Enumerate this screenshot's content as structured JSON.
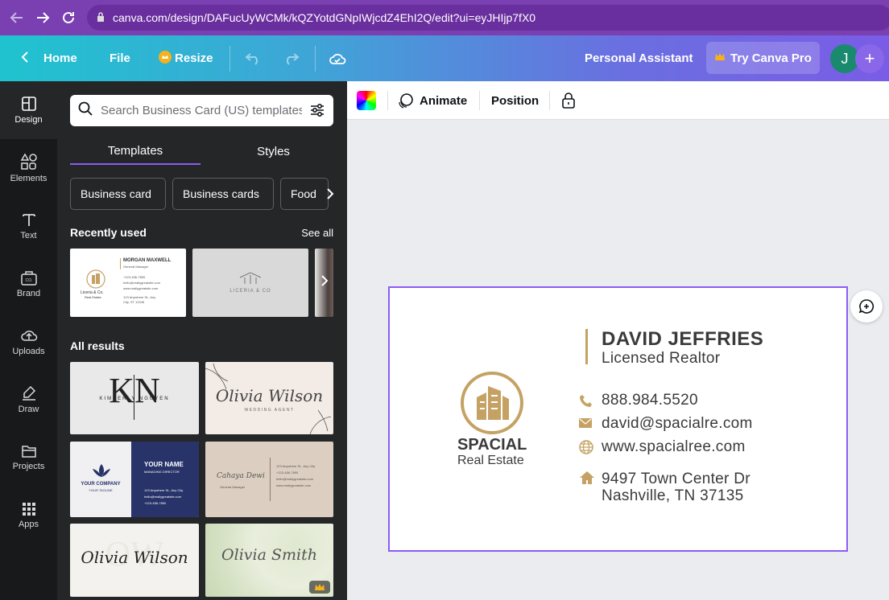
{
  "browser": {
    "url": "canva.com/design/DAFucUyWCMk/kQZYotdGNpIWjcdZ4EhI2Q/edit?ui=eyJHIjp7fX0"
  },
  "topbar": {
    "home_label": "Home",
    "file_label": "File",
    "resize_label": "Resize",
    "assistant_label": "Personal Assistant",
    "try_pro_label": "Try Canva Pro",
    "avatar_initial": "J",
    "plus_label": "+"
  },
  "rail": {
    "items": [
      {
        "label": "Design",
        "icon": "design-icon"
      },
      {
        "label": "Elements",
        "icon": "elements-icon"
      },
      {
        "label": "Text",
        "icon": "text-icon"
      },
      {
        "label": "Brand",
        "icon": "brand-icon"
      },
      {
        "label": "Uploads",
        "icon": "uploads-icon"
      },
      {
        "label": "Draw",
        "icon": "draw-icon"
      },
      {
        "label": "Projects",
        "icon": "projects-icon"
      },
      {
        "label": "Apps",
        "icon": "apps-icon"
      }
    ]
  },
  "panel": {
    "search_placeholder": "Search Business Card (US) templates",
    "tabs": [
      "Templates",
      "Styles"
    ],
    "chips": [
      "Business card",
      "Business cards",
      "Food"
    ],
    "recently_used": "Recently used",
    "see_all": "See all",
    "all_results": "All results",
    "recent_thumbs": [
      {
        "name": "MORGAN MAXWELL",
        "role": "General Manager",
        "brand": "Liceria & Co.",
        "sub": "Real Estate",
        "phone": "+123-456-7890",
        "email": "hello@reallygreatsite.com",
        "web": "www.reallygreatsite.com",
        "addr1": "123 Anywhere St., Any",
        "addr2": "City, ST 12345"
      },
      {
        "brand": "LICERIA & CO"
      }
    ],
    "results": [
      {
        "text": "KIMBERLY NGUYEN",
        "mono": "KN"
      },
      {
        "text": "Olivia Wilson",
        "sub": "WEDDING AGENT"
      },
      {
        "company": "YOUR COMPANY",
        "tagline": "YOUR TAGLINE",
        "name": "YOUR NAME",
        "title": "MANAGING DIRECTOR",
        "addr": "123 Anywhere St., Any City",
        "email": "hello@reallygreatsite.com",
        "phone": "+123-456-7890"
      },
      {
        "name": "Cahaya Dewi",
        "title": "General Manager",
        "addr": "123 Anywhere St., Any City",
        "phone": "+123-456-7890",
        "email": "hello@reallygreatsite.com",
        "web": "www.reallygreatsite.com"
      },
      {
        "text": "Olivia Wilson",
        "mono": "OW"
      },
      {
        "text": "Olivia Smith"
      }
    ]
  },
  "toolbar": {
    "animate_label": "Animate",
    "position_label": "Position"
  },
  "card": {
    "brand_line1": "SPACIAL",
    "brand_line2": "Real Estate",
    "name": "DAVID JEFFRIES",
    "role": "Licensed Realtor",
    "phone": "888.984.5520",
    "email": "david@spacialre.com",
    "website": "www.spacialree.com",
    "address_line1": "9497 Town Center Dr",
    "address_line2": "Nashville, TN 37135",
    "accent_color": "#c5a263"
  },
  "colors": {
    "selection": "#8b5cf6",
    "panel_bg": "#252627",
    "rail_bg": "#18191b"
  }
}
